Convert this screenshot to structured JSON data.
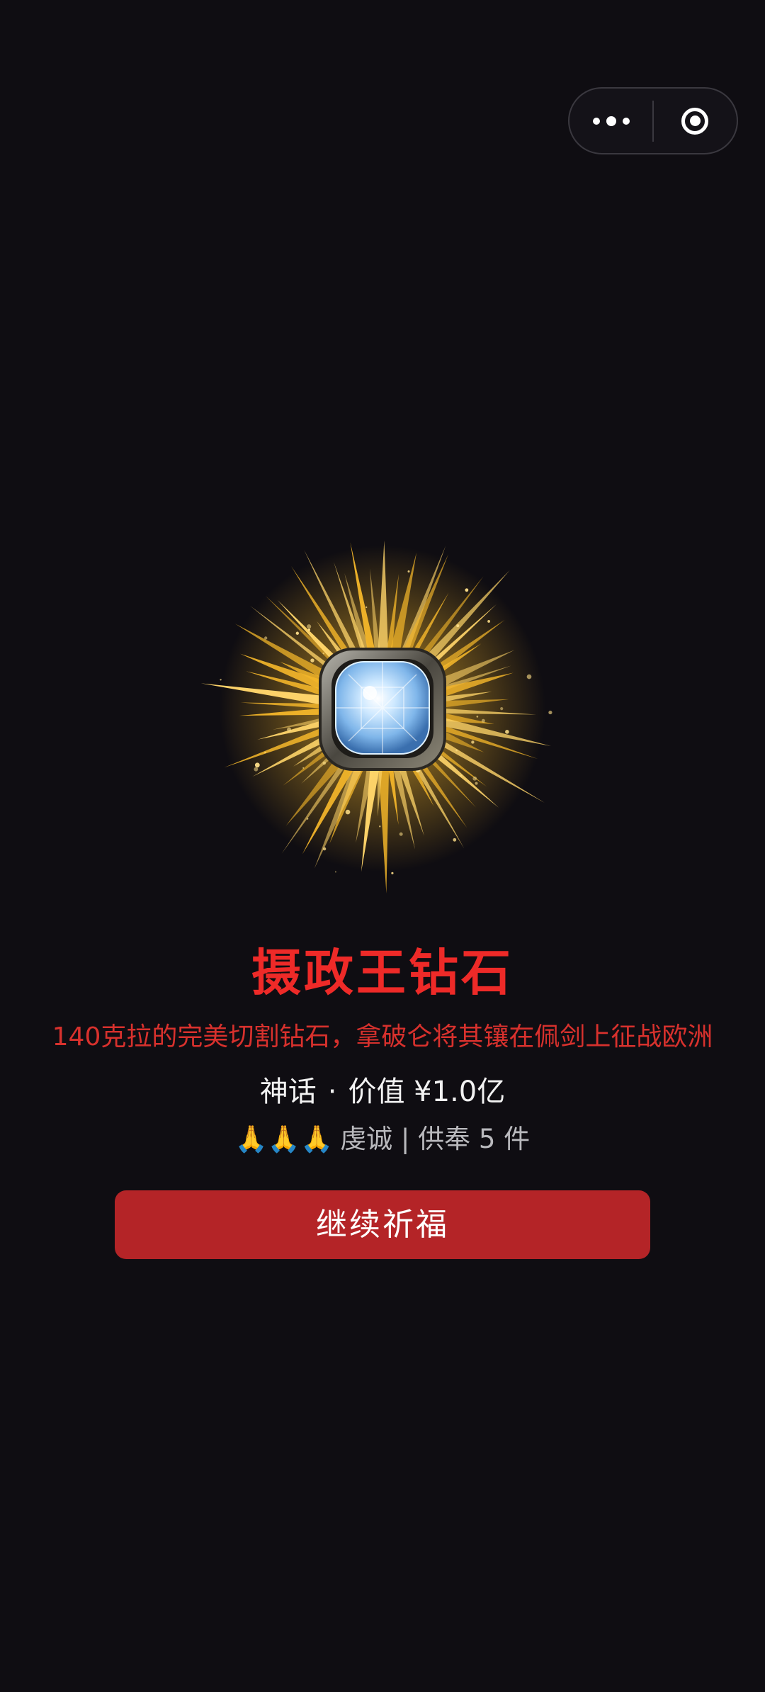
{
  "capsule": {
    "more_icon": "more-dots-icon",
    "close_icon": "target-icon"
  },
  "item": {
    "image_icon": "regent-diamond-ring-icon",
    "name": "摄政王钻石",
    "description": "140克拉的完美切割钻石，拿破仑将其镶在佩剑上征战欧洲",
    "rarity": "神话",
    "value_label": "价值 ¥1.0亿",
    "stats_emoji": "🙏🙏🙏",
    "stats_text": "虔诚 | 供奉 5 件",
    "colors": {
      "title": "#ee2a28",
      "description": "#d8312d",
      "gold": "#f2b52a"
    }
  },
  "actions": {
    "continue_label": "继续祈福",
    "button_color": "#b42427"
  }
}
